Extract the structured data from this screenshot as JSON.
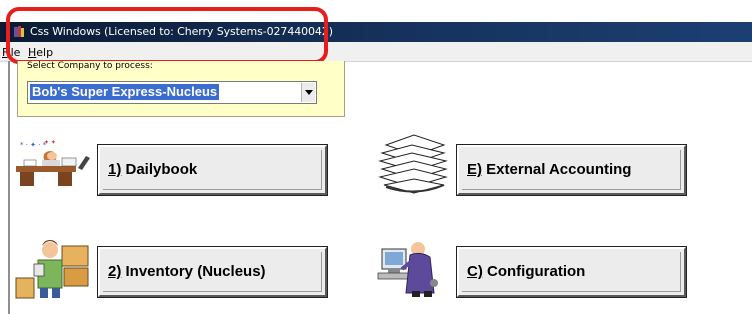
{
  "window": {
    "title": "Css Windows (Licensed to: Cherry Systems-027440042)"
  },
  "menu": {
    "items": [
      {
        "label": "File"
      },
      {
        "label": "Help"
      }
    ]
  },
  "company": {
    "label": "Select Company to process:",
    "selected": "Bob's Super Express-Nucleus"
  },
  "buttons": {
    "dailybook": "1) Dailybook",
    "external_accounting": "E) External Accounting",
    "inventory": "2) Inventory (Nucleus)",
    "configuration": "C) Configuration"
  },
  "icons": {
    "app": "app-books-icon",
    "dailybook": "person-at-desk-icon",
    "external_accounting": "paper-stack-icon",
    "inventory": "person-with-boxes-icon",
    "configuration": "technician-at-computer-icon"
  },
  "colors": {
    "title_bar": "#15315a",
    "company_panel": "#ffffc8",
    "selection": "#3b6ccf",
    "annotation": "#e61e1e"
  }
}
